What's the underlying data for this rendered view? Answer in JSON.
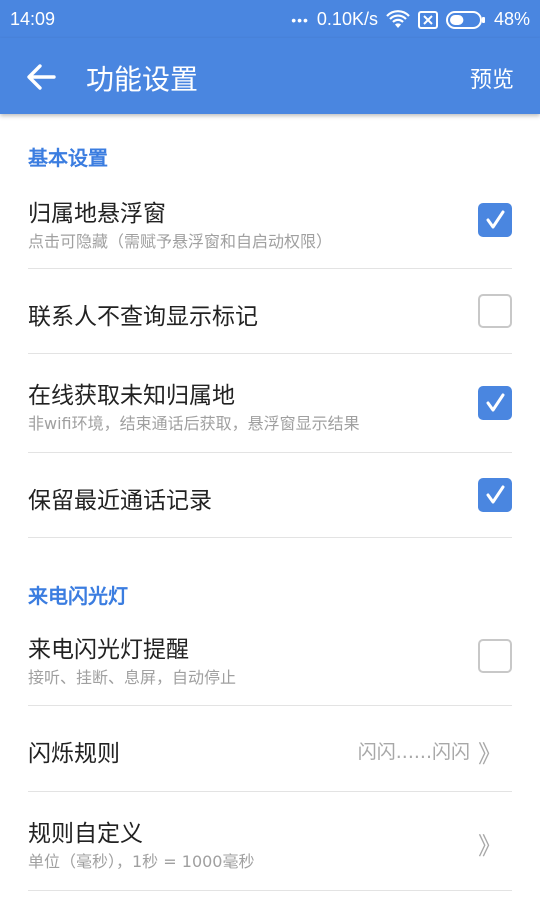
{
  "status_bar": {
    "time": "14:09",
    "dots": "•••",
    "speed": "0.10K/s",
    "battery": "48%",
    "battery_level": 0.48
  },
  "app_bar": {
    "title": "功能设置",
    "preview_label": "预览"
  },
  "sections": [
    {
      "header": "基本设置"
    },
    {
      "header": "来电闪光灯"
    }
  ],
  "settings": {
    "float_window": {
      "title": "归属地悬浮窗",
      "subtitle": "点击可隐藏（需赋予悬浮窗和自启动权限）",
      "checked": true
    },
    "contacts_no_query": {
      "title": "联系人不查询显示标记",
      "checked": false
    },
    "online_lookup": {
      "title": "在线获取未知归属地",
      "subtitle": "非wifi环境，结束通话后获取，悬浮窗显示结果",
      "checked": true
    },
    "keep_call_log": {
      "title": "保留最近通话记录",
      "checked": true
    },
    "flash_alert": {
      "title": "来电闪光灯提醒",
      "subtitle": "接听、挂断、息屏，自动停止",
      "checked": false
    },
    "flash_rule": {
      "title": "闪烁规则",
      "value": "闪闪......闪闪",
      "chevron": "》"
    },
    "custom_rule": {
      "title": "规则自定义",
      "subtitle": "单位（毫秒），1秒 = 1000毫秒",
      "chevron": "》"
    }
  }
}
